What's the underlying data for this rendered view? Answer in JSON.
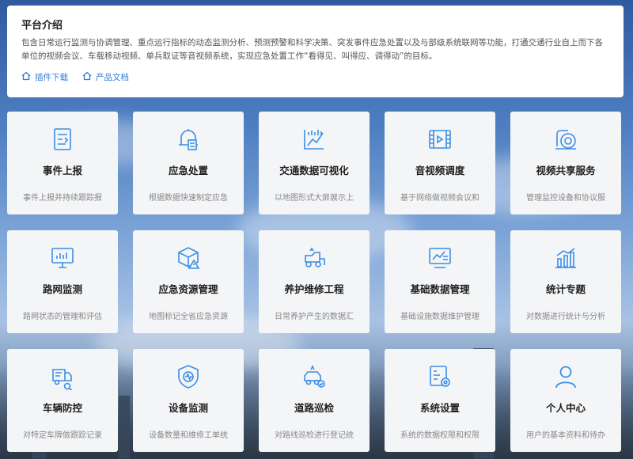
{
  "intro": {
    "title": "平台介绍",
    "description": "包含日常运行监测与协调管理、重点运行指标的动态监测分析、预测预警和科学决策、突发事件应急处置以及与部级系统联网等功能，打通交通行业自上而下各单位的视频会议、车载移动视频、单兵取证等音视频系统，实现应急处置工作“看得见、叫得应、调得动”的目标。",
    "links": [
      {
        "label": "插件下载",
        "icon": "home-icon"
      },
      {
        "label": "产品文档",
        "icon": "home-icon"
      }
    ]
  },
  "accent_color": "#3a8ee6",
  "modules": [
    {
      "title": "事件上报",
      "desc": "事件上报并持续跟踪报",
      "icon": "report-icon"
    },
    {
      "title": "应急处置",
      "desc": "根据数据快速制定应急",
      "icon": "alarm-bell-icon"
    },
    {
      "title": "交通数据可视化",
      "desc": "以地图形式大屏展示上",
      "icon": "chart-trend-icon"
    },
    {
      "title": "音视频调度",
      "desc": "基于网络做视频会议和",
      "icon": "film-icon"
    },
    {
      "title": "视频共享服务",
      "desc": "管理监控设备和协议服",
      "icon": "video-share-icon"
    },
    {
      "title": "路网监测",
      "desc": "路网状态的管理和评估",
      "icon": "monitor-icon"
    },
    {
      "title": "应急资源管理",
      "desc": "地图标记全省应急资源",
      "icon": "box-warning-icon"
    },
    {
      "title": "养护维修工程",
      "desc": "日常养护产生的数据汇",
      "icon": "roller-truck-icon"
    },
    {
      "title": "基础数据管理",
      "desc": "基础设施数据维护管理",
      "icon": "data-board-icon"
    },
    {
      "title": "统计专题",
      "desc": "对数据进行统计与分析",
      "icon": "statistics-icon"
    },
    {
      "title": "车辆防控",
      "desc": "对特定车牌做跟踪记录",
      "icon": "truck-search-icon"
    },
    {
      "title": "设备监测",
      "desc": "设备数量和维修工单统",
      "icon": "shield-gauge-icon"
    },
    {
      "title": "道路巡检",
      "desc": "对路线巡检进行登记统",
      "icon": "patrol-car-icon"
    },
    {
      "title": "系统设置",
      "desc": "系统的数据权限和权限",
      "icon": "settings-list-icon"
    },
    {
      "title": "个人中心",
      "desc": "用户的基本资料和待办",
      "icon": "user-icon"
    }
  ]
}
